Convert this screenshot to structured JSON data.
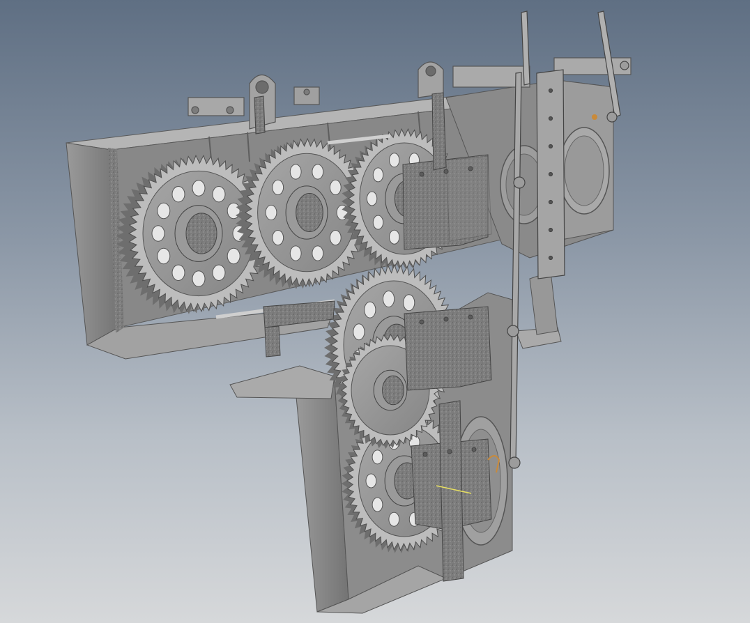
{
  "scene": {
    "background_top": "#5f6f83",
    "background_bottom": "#d6d8da",
    "body_color": "#8f8f8f",
    "body_shadow": "#6e6e6e",
    "body_light": "#b3b3b3",
    "section_color": "#7a7a7a",
    "highlight_color": "#e8e060",
    "accent_orange": "#c98a3a",
    "gear_count": 6,
    "labels": []
  }
}
